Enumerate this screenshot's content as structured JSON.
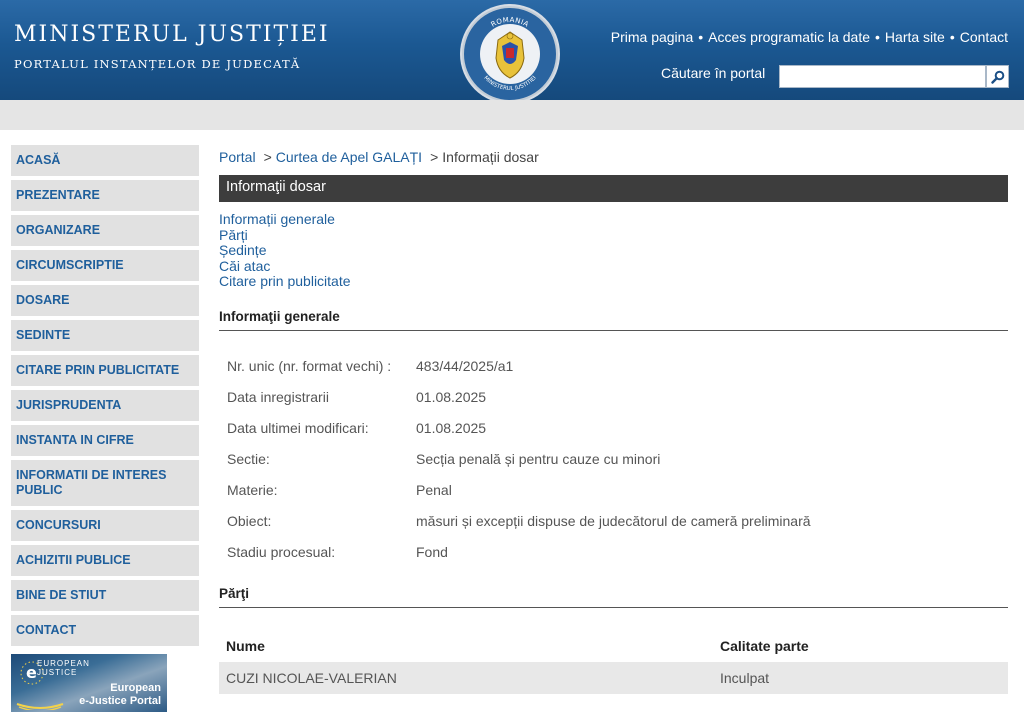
{
  "header": {
    "title": "MINISTERUL JUSTIȚIEI",
    "subtitle": "PORTALUL INSTANȚELOR DE JUDECATĂ",
    "emblem_top_text": "ROMANIA",
    "emblem_bottom_text": "MINISTERUL JUSTITIEI",
    "top_links": [
      "Prima pagina",
      "Acces programatic la date",
      "Harta site",
      "Contact"
    ],
    "separator": "•",
    "search_label": "Căutare în portal",
    "search_value": "",
    "search_placeholder": ""
  },
  "sidebar": {
    "items": [
      {
        "label": "ACASĂ"
      },
      {
        "label": "PREZENTARE"
      },
      {
        "label": "ORGANIZARE"
      },
      {
        "label": "CIRCUMSCRIPTIE"
      },
      {
        "label": "DOSARE"
      },
      {
        "label": "SEDINTE"
      },
      {
        "label": "CITARE PRIN PUBLICITATE"
      },
      {
        "label": "JURISPRUDENTA"
      },
      {
        "label": "INSTANTA IN CIFRE"
      },
      {
        "label": "INFORMATII DE INTERES PUBLIC"
      },
      {
        "label": "CONCURSURI"
      },
      {
        "label": "ACHIZITII PUBLICE"
      },
      {
        "label": "BINE DE STIUT"
      },
      {
        "label": "CONTACT"
      }
    ],
    "ejustice": {
      "top_line1": "EUROPEAN",
      "top_line2": "JUSTICE",
      "bottom_line1": "European",
      "bottom_line2": "e-Justice Portal"
    }
  },
  "breadcrumb": {
    "items": [
      "Portal",
      "Curtea de Apel GALAȚI"
    ],
    "current": "Informații dosar",
    "separator": ">"
  },
  "page_title": "Informaţii dosar",
  "anchors": [
    "Informații generale",
    "Părți",
    "Ședințe",
    "Căi atac",
    "Citare prin publicitate"
  ],
  "general_info": {
    "heading": "Informaţii generale",
    "rows": [
      {
        "label": "Nr. unic (nr. format vechi) :",
        "value": "483/44/2025/a1"
      },
      {
        "label": "Data inregistrarii",
        "value": "01.08.2025"
      },
      {
        "label": "Data ultimei modificari:",
        "value": "01.08.2025"
      },
      {
        "label": "Sectie:",
        "value": "Secția penală și pentru cauze cu minori"
      },
      {
        "label": "Materie:",
        "value": "Penal"
      },
      {
        "label": "Obiect:",
        "value": "măsuri și excepții dispuse de judecătorul de cameră preliminară"
      },
      {
        "label": "Stadiu procesual:",
        "value": "Fond"
      }
    ]
  },
  "parti": {
    "heading": "Părţi",
    "columns": [
      "Nume",
      "Calitate parte"
    ],
    "rows": [
      {
        "nume": "CUZI NICOLAE-VALERIAN",
        "calitate": "Inculpat"
      }
    ]
  },
  "colors": {
    "header_blue": "#1b5892",
    "link_blue": "#1f5f9c",
    "title_bar": "#3d3d3d",
    "sidebar_bg": "#e1e1e1"
  }
}
